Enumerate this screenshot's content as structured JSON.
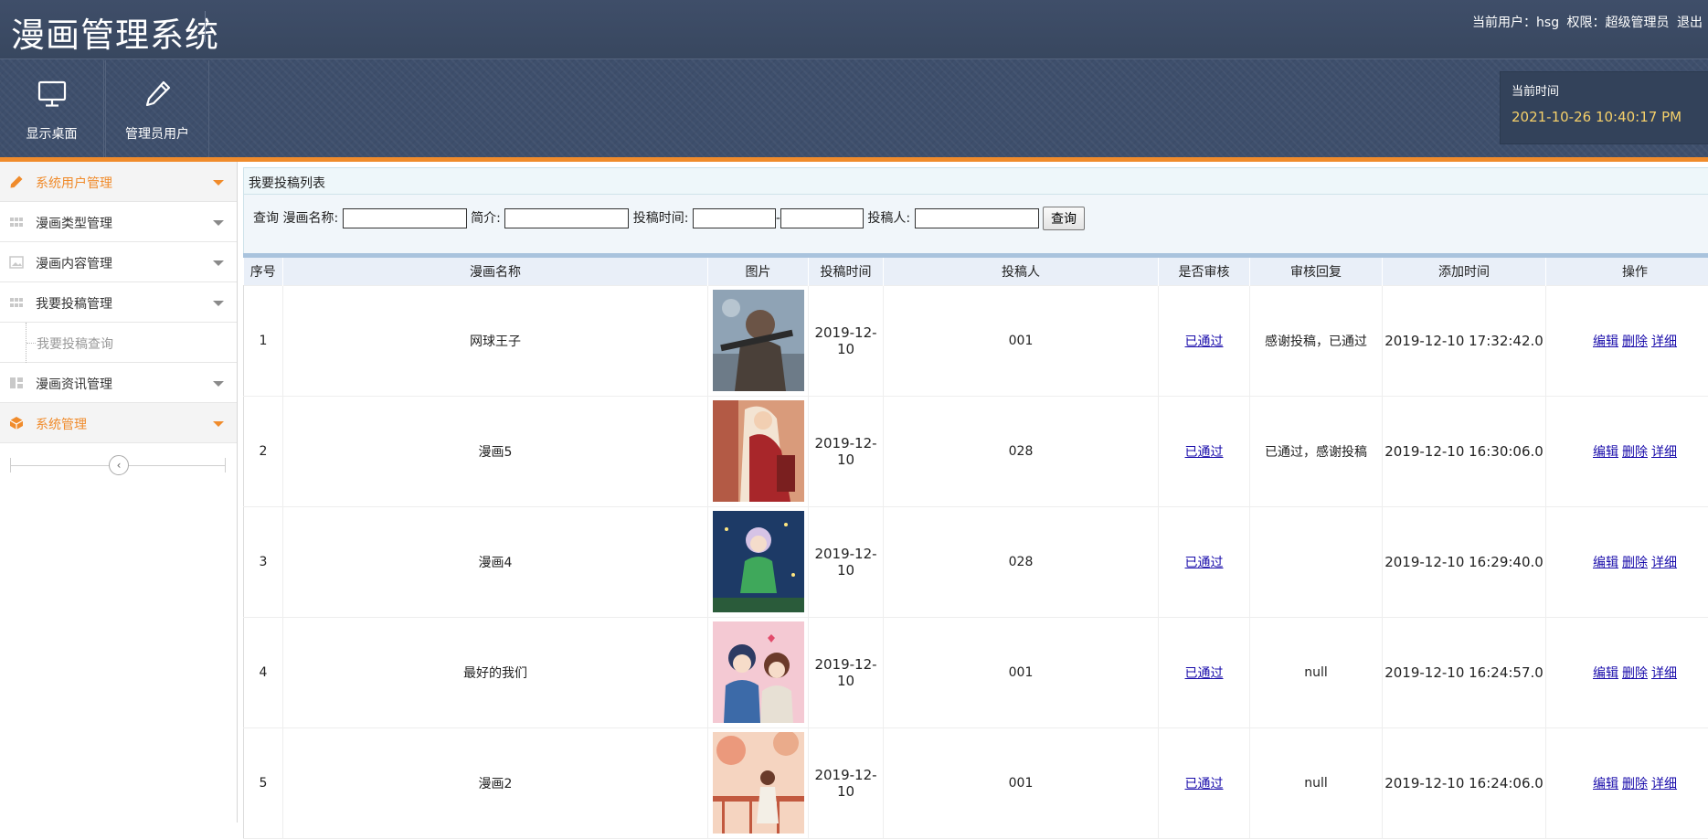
{
  "header": {
    "app_title": "漫画管理系统",
    "user_label": "当前用户：hsg",
    "role_label": "权限：超级管理员",
    "logout_label": "退出"
  },
  "toolbar": {
    "desktop_label": "显示桌面",
    "admin_label": "管理员用户"
  },
  "clock": {
    "label": "当前时间",
    "value": "2021-10-26 10:40:17 PM"
  },
  "sidebar": {
    "items": [
      {
        "label": "系统用户管理",
        "icon": "pencil-icon"
      },
      {
        "label": "漫画类型管理",
        "icon": "grid-icon"
      },
      {
        "label": "漫画内容管理",
        "icon": "image-icon"
      },
      {
        "label": "我要投稿管理",
        "icon": "grid-icon"
      },
      {
        "label": "我要投稿查询",
        "icon": ""
      },
      {
        "label": "漫画资讯管理",
        "icon": "layout-icon"
      },
      {
        "label": "系统管理",
        "icon": "box-icon"
      }
    ]
  },
  "panel": {
    "title": "我要投稿列表"
  },
  "search": {
    "prefix": "查询",
    "name_label": "漫画名称:",
    "intro_label": "简介:",
    "time_label": "投稿时间:",
    "range_sep": "-",
    "author_label": "投稿人:",
    "button_label": "查询"
  },
  "table": {
    "headers": [
      "序号",
      "漫画名称",
      "图片",
      "投稿时间",
      "投稿人",
      "是否审核",
      "审核回复",
      "添加时间",
      "操作"
    ],
    "rows": [
      {
        "no": "1",
        "name": "网球王子",
        "time": "2019-12-10",
        "author": "001",
        "status": "已通过",
        "reply": "感谢投稿，已通过",
        "added": "2019-12-10 17:32:42.0"
      },
      {
        "no": "2",
        "name": "漫画5",
        "time": "2019-12-10",
        "author": "028",
        "status": "已通过",
        "reply": "已通过，感谢投稿",
        "added": "2019-12-10 16:30:06.0"
      },
      {
        "no": "3",
        "name": "漫画4",
        "time": "2019-12-10",
        "author": "028",
        "status": "已通过",
        "reply": "",
        "added": "2019-12-10 16:29:40.0"
      },
      {
        "no": "4",
        "name": "最好的我们",
        "time": "2019-12-10",
        "author": "001",
        "status": "已通过",
        "reply": "null",
        "added": "2019-12-10 16:24:57.0"
      },
      {
        "no": "5",
        "name": "漫画2",
        "time": "2019-12-10",
        "author": "001",
        "status": "已通过",
        "reply": "null",
        "added": "2019-12-10 16:24:06.0"
      }
    ],
    "ops": {
      "edit": "编辑",
      "delete": "删除",
      "detail": "详细"
    }
  },
  "colors": {
    "accent": "#f08b2b",
    "header_bg": "#3e4f6c",
    "clock_text": "#f5d06a",
    "link": "#1a0dab"
  }
}
